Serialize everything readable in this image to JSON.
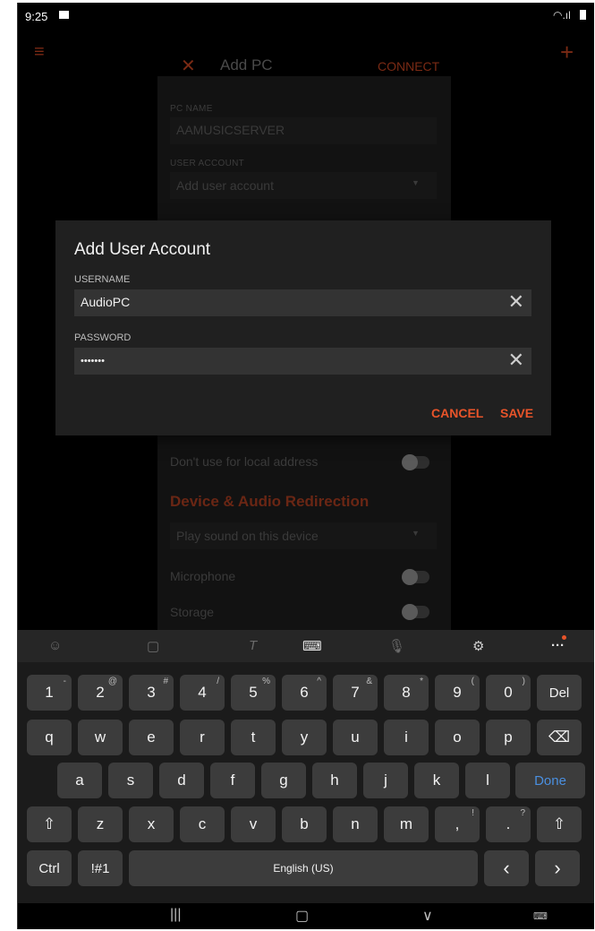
{
  "status_bar": {
    "time": "9:25"
  },
  "background": {
    "title": "Add PC",
    "connect": "CONNECT",
    "pc_name_label": "PC NAME",
    "pc_name_value": "AAMUSICSERVER",
    "user_account_label": "USER ACCOUNT",
    "user_account_value": "Add user account",
    "local_address": "Don't use for local address",
    "section_title": "Device & Audio Redirection",
    "sound_value": "Play sound on this device",
    "microphone": "Microphone",
    "storage": "Storage"
  },
  "dialog": {
    "title": "Add User Account",
    "username_label": "USERNAME",
    "username_value": "AudioPC",
    "password_label": "PASSWORD",
    "password_value": "•••••••",
    "cancel": "CANCEL",
    "save": "SAVE"
  },
  "keyboard": {
    "row1": [
      {
        "k": "1",
        "s": "-"
      },
      {
        "k": "2",
        "s": "@"
      },
      {
        "k": "3",
        "s": "#"
      },
      {
        "k": "4",
        "s": "/"
      },
      {
        "k": "5",
        "s": "%"
      },
      {
        "k": "6",
        "s": "^"
      },
      {
        "k": "7",
        "s": "&"
      },
      {
        "k": "8",
        "s": "*"
      },
      {
        "k": "9",
        "s": "("
      },
      {
        "k": "0",
        "s": ")"
      },
      {
        "k": "Del",
        "s": ""
      }
    ],
    "row2": [
      "q",
      "w",
      "e",
      "r",
      "t",
      "y",
      "u",
      "i",
      "o",
      "p"
    ],
    "row3": [
      "a",
      "s",
      "d",
      "f",
      "g",
      "h",
      "j",
      "k",
      "l"
    ],
    "done": "Done",
    "row4": [
      "z",
      "x",
      "c",
      "v",
      "b",
      "n",
      "m"
    ],
    "comma": ",",
    "comma_sup": "!",
    "period": ".",
    "period_sup": "?",
    "ctrl": "Ctrl",
    "symbols": "!#1",
    "space": "English (US)"
  },
  "colors": {
    "accent": "#e8542a",
    "done": "#4a8fe0"
  }
}
